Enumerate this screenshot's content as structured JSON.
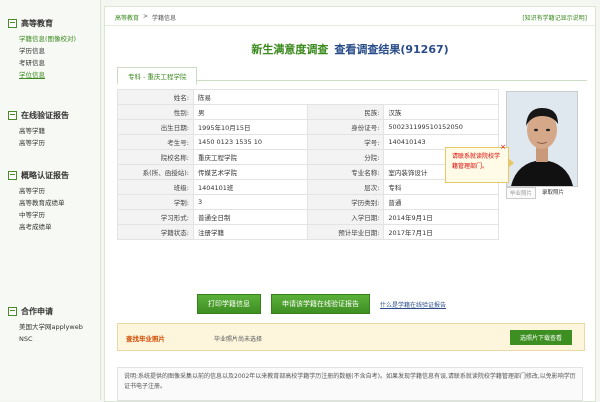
{
  "sidebar": {
    "sections": [
      {
        "title": "高等教育",
        "items": [
          {
            "label": "学籍信息(图像校对)",
            "style": "green"
          },
          {
            "label": "学历信息",
            "style": "normal"
          },
          {
            "label": "考研信息",
            "style": "normal"
          },
          {
            "label": "学位信息",
            "style": "active"
          }
        ]
      },
      {
        "title": "在线验证报告",
        "items": [
          {
            "label": "高等学籍",
            "style": "normal"
          },
          {
            "label": "高等学历",
            "style": "normal"
          }
        ]
      },
      {
        "title": "概略认证报告",
        "items": [
          {
            "label": "高等学历",
            "style": "normal"
          },
          {
            "label": "高等教育成绩单",
            "style": "normal"
          },
          {
            "label": "中等学历",
            "style": "normal"
          },
          {
            "label": "高考成绩单",
            "style": "normal"
          }
        ]
      },
      {
        "title": "合作申请",
        "items": [
          {
            "label": "美国大学网applyweb",
            "style": "normal"
          },
          {
            "label": "NSC",
            "style": "normal"
          }
        ]
      }
    ]
  },
  "breadcrumb": {
    "root": "高等教育",
    "sep": ">",
    "current": "学籍信息"
  },
  "top_link": "[知识有学籍记显示说明]",
  "title": {
    "survey": "新生满意度调查",
    "results": "查看调查结果(91267)"
  },
  "tab_label": "专科 - 重庆工程学院",
  "info": {
    "rows": [
      [
        {
          "label": "姓名:",
          "value": "陈易"
        },
        {
          "label": "",
          "value": ""
        }
      ],
      [
        {
          "label": "性别:",
          "value": "男"
        },
        {
          "label": "民族:",
          "value": "汉族"
        }
      ],
      [
        {
          "label": "出生日期:",
          "value": "1995年10月15日"
        },
        {
          "label": "身份证号:",
          "value": "500231199510152050"
        }
      ],
      [
        {
          "label": "考生号:",
          "value": "1450 0123 1535 10"
        },
        {
          "label": "学号:",
          "value": "140410143"
        }
      ],
      [
        {
          "label": "院校名称:",
          "value": "重庆工程学院"
        },
        {
          "label": "分院:",
          "value": ""
        }
      ],
      [
        {
          "label": "系(所、函授站):",
          "value": "传媒艺术学院"
        },
        {
          "label": "专业名称:",
          "value": "室内装饰设计"
        }
      ],
      [
        {
          "label": "班级:",
          "value": "1404101班"
        },
        {
          "label": "层次:",
          "value": "专科"
        }
      ],
      [
        {
          "label": "学制:",
          "value": "3"
        },
        {
          "label": "学历类别:",
          "value": "普通"
        }
      ],
      [
        {
          "label": "学习形式:",
          "value": "普通全日制"
        },
        {
          "label": "入学日期:",
          "value": "2014年9月1日"
        }
      ],
      [
        {
          "label": "学籍状态:",
          "value": "注册学籍",
          "red": true
        },
        {
          "label": "预计毕业日期:",
          "value": "2017年7月1日"
        }
      ]
    ]
  },
  "photo_buttons": {
    "grad": "毕业照片",
    "admit": "录取照片"
  },
  "tooltip": {
    "text": "请联系就读院校学籍管理部门。",
    "close": "×"
  },
  "actions": {
    "print": "打印学籍信息",
    "apply": "申请该学籍在线验证报告",
    "what": "什么是学籍在线验证报告"
  },
  "find_photo": {
    "title": "查找毕业照片",
    "status": "毕业照片尚未选择",
    "button": "选照片下载查看"
  },
  "note": "说明:系统提供的图像采集以前的信息以及2002年以来教育部高校学籍学历注册的数据(不含自考)。如果发现学籍信息有误,请联系就读院校学籍管理部门修改,以免影响学历证书电子注册。",
  "colors": {
    "accent": "#3a8a1e",
    "link": "#2a4d8a",
    "warn": "#d00000"
  }
}
